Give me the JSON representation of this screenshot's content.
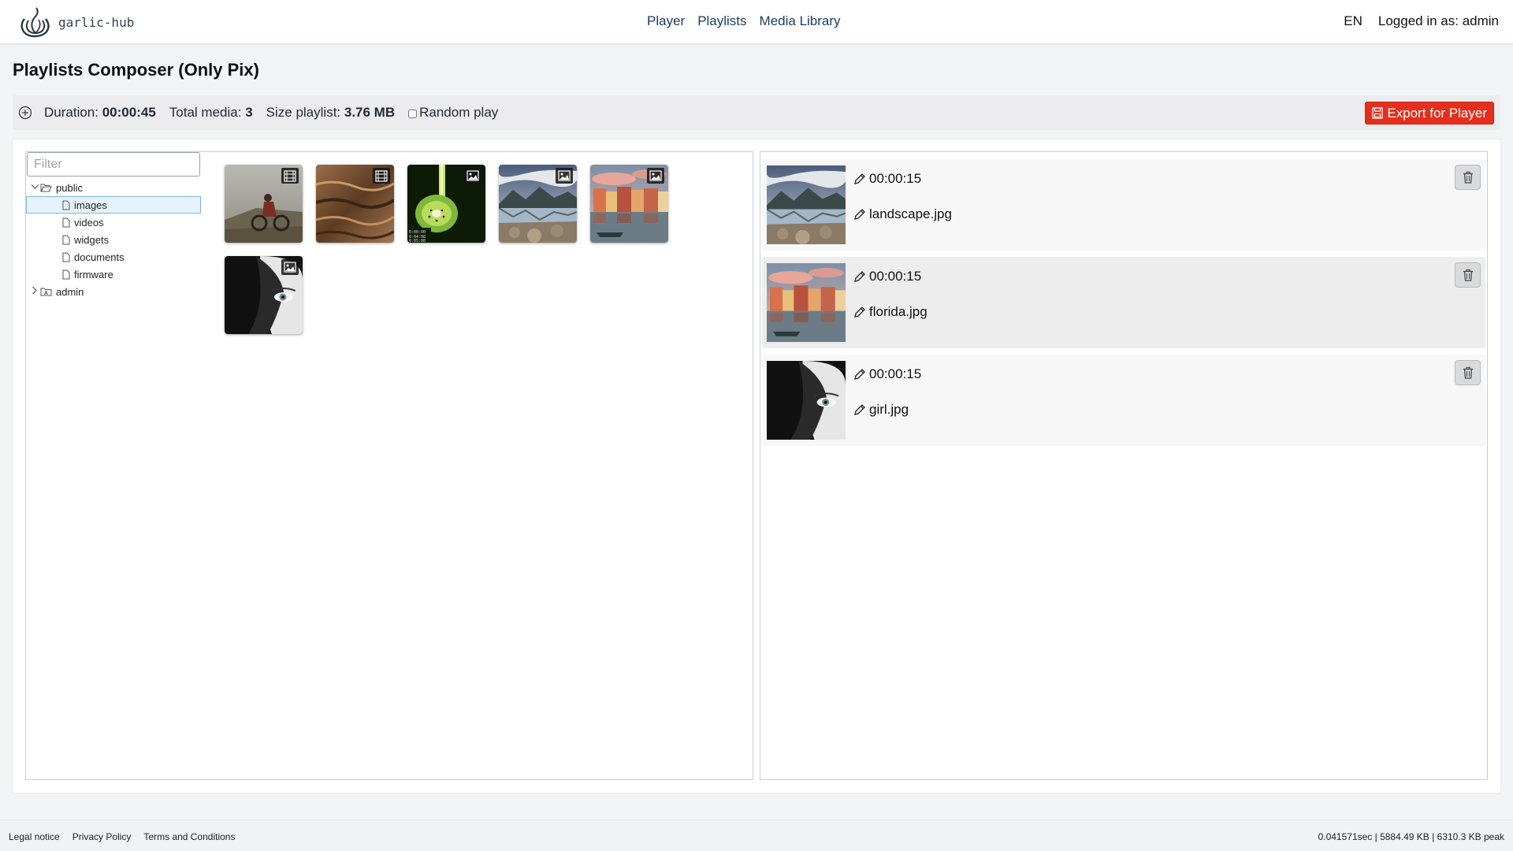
{
  "header": {
    "logo_text": "garlic-hub",
    "nav": [
      "Player",
      "Playlists",
      "Media Library"
    ],
    "language": "EN",
    "logged_in": "Logged in as: admin"
  },
  "page": {
    "title": "Playlists Composer (Only Pix)"
  },
  "toolbar": {
    "duration_label": "Duration:",
    "duration_value": "00:00:45",
    "total_label": "Total media:",
    "total_value": "3",
    "size_label": "Size playlist:",
    "size_value": "3.76 MB",
    "random_label": "Random play",
    "random_checked": false,
    "export_label": "Export for Player"
  },
  "media_browser": {
    "filter_placeholder": "Filter",
    "tree": [
      {
        "label": "public",
        "expanded": true,
        "type": "folder-open"
      },
      {
        "label": "images",
        "type": "file",
        "selected": true
      },
      {
        "label": "videos",
        "type": "file"
      },
      {
        "label": "widgets",
        "type": "file"
      },
      {
        "label": "documents",
        "type": "file"
      },
      {
        "label": "firmware",
        "type": "file"
      },
      {
        "label": "admin",
        "expanded": false,
        "type": "folder-shared"
      }
    ],
    "thumbnails": [
      {
        "subject": "bike-road",
        "type": "video"
      },
      {
        "subject": "water-waves",
        "type": "video"
      },
      {
        "subject": "kiwi-drink",
        "type": "image"
      },
      {
        "subject": "mountain-lake",
        "type": "image"
      },
      {
        "subject": "harbor-houses",
        "type": "image"
      },
      {
        "subject": "girl-veil",
        "type": "image"
      }
    ]
  },
  "playlist": {
    "items": [
      {
        "duration": "00:00:15",
        "name": "landscape.jpg",
        "subject": "mountain-lake"
      },
      {
        "duration": "00:00:15",
        "name": "florida.jpg",
        "subject": "harbor-houses"
      },
      {
        "duration": "00:00:15",
        "name": "girl.jpg",
        "subject": "girl-veil"
      }
    ]
  },
  "footer": {
    "links": [
      "Legal notice",
      "Privacy Policy",
      "Terms and Conditions"
    ],
    "stats": "0.041571sec | 5884.49 KB | 6310.3 KB peak"
  },
  "colors": {
    "accent": "#e62e1c",
    "nav_link": "#1e3a5f",
    "selection": "#e6f2fb"
  }
}
